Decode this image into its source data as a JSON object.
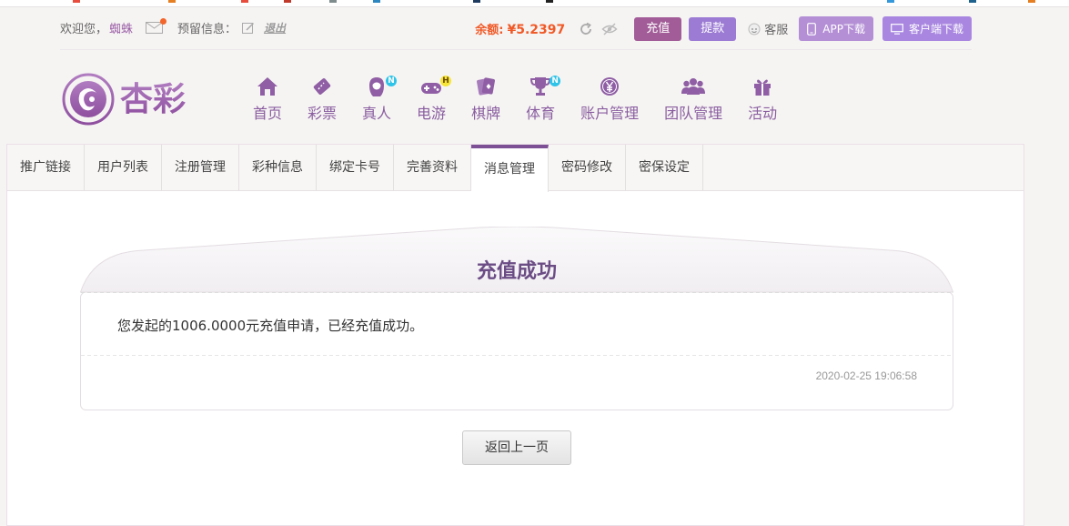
{
  "topbar": {
    "welcome": "欢迎您，",
    "username": "蜘蛛",
    "notice_label": "预留信息：",
    "logout": "退出",
    "balance_label": "余额:",
    "balance_value": "¥5.2397",
    "recharge": "充值",
    "withdraw": "提款",
    "customer_service": "客服",
    "app_download": "APP下载",
    "client_download": "客户端下载",
    "colors": {
      "accent": "#a25c98",
      "balance": "#f05a28"
    }
  },
  "nav": {
    "items": [
      {
        "label": "首页",
        "icon": "home-icon",
        "badge": ""
      },
      {
        "label": "彩票",
        "icon": "ticket-icon",
        "badge": ""
      },
      {
        "label": "真人",
        "icon": "dealer-icon",
        "badge": "N"
      },
      {
        "label": "电游",
        "icon": "gamepad-icon",
        "badge": "H"
      },
      {
        "label": "棋牌",
        "icon": "cards-icon",
        "badge": ""
      },
      {
        "label": "体育",
        "icon": "trophy-icon",
        "badge": "N"
      },
      {
        "label": "账户管理",
        "icon": "yen-coin-icon",
        "badge": ""
      },
      {
        "label": "团队管理",
        "icon": "team-icon",
        "badge": ""
      },
      {
        "label": "活动",
        "icon": "gift-icon",
        "badge": ""
      }
    ]
  },
  "tabs": [
    {
      "label": "推广链接",
      "active": false
    },
    {
      "label": "用户列表",
      "active": false
    },
    {
      "label": "注册管理",
      "active": false
    },
    {
      "label": "彩种信息",
      "active": false
    },
    {
      "label": "绑定卡号",
      "active": false
    },
    {
      "label": "完善资料",
      "active": false
    },
    {
      "label": "消息管理",
      "active": true
    },
    {
      "label": "密码修改",
      "active": false
    },
    {
      "label": "密保设定",
      "active": false
    }
  ],
  "message": {
    "title": "充值成功",
    "body": "您发起的1006.0000元充值申请，已经充值成功。",
    "time": "2020-02-25 19:06:58"
  },
  "back_button": "返回上一页"
}
